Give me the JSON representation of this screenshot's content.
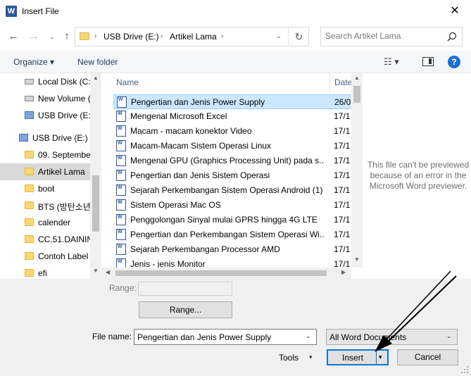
{
  "window": {
    "title": "Insert File",
    "logo": "W",
    "close_glyph": "✕"
  },
  "nav": {
    "back_glyph": "←",
    "forward_glyph": "→",
    "recent_glyph": "⌄",
    "up_glyph": "↑",
    "breadcrumbs": [
      "USB Drive (E:)",
      "Artikel Lama"
    ],
    "separator": "›",
    "dropdown_glyph": "⌄",
    "refresh_glyph": "↻",
    "search_placeholder": "Search Artikel Lama"
  },
  "toolbar": {
    "organize": "Organize ▾",
    "new_folder": "New folder",
    "view_glyph": "☷ ▾",
    "help": "?"
  },
  "nav_pane": {
    "items": [
      {
        "label": "Local Disk (C:)",
        "icon": "drive-icon"
      },
      {
        "label": "New Volume (",
        "icon": "drive-icon"
      },
      {
        "label": "USB Drive (E:)",
        "icon": "usb-icon"
      },
      {
        "label": "USB Drive (E:)",
        "icon": "usb-icon"
      },
      {
        "label": "09. September",
        "icon": "folder-icon"
      },
      {
        "label": "Artikel Lama",
        "icon": "folder-icon"
      },
      {
        "label": "boot",
        "icon": "folder-icon"
      },
      {
        "label": "BTS (방탄소년",
        "icon": "folder-icon"
      },
      {
        "label": "calender",
        "icon": "folder-icon"
      },
      {
        "label": "CC.51.DAININ",
        "icon": "folder-icon"
      },
      {
        "label": "Contoh Label",
        "icon": "folder-icon"
      },
      {
        "label": "efi",
        "icon": "folder-icon"
      }
    ],
    "scroll_up": "▲",
    "scroll_down": "▼"
  },
  "file_list": {
    "columns": {
      "name": "Name",
      "date": "Date"
    },
    "files": [
      {
        "name": "Pengertian dan Jenis Power Supply",
        "date": "26/0"
      },
      {
        "name": "Mengenal Microsoft Excel",
        "date": "17/1"
      },
      {
        "name": "Macam - macam konektor Video",
        "date": "17/1"
      },
      {
        "name": "Macam-Macam Sistem Operasi Linux",
        "date": "17/1"
      },
      {
        "name": "Mengenal GPU (Graphics Processing Unit) pada s...",
        "date": "17/1"
      },
      {
        "name": "Pengertian dan Jenis Sistem Operasi",
        "date": "17/1"
      },
      {
        "name": "Sejarah Perkembangan Sistem Operasi Android (1)",
        "date": "17/1"
      },
      {
        "name": "Sistem Operasi Mac OS",
        "date": "17/1"
      },
      {
        "name": "Penggolongan Sinyal mulai GPRS hingga 4G LTE",
        "date": "17/1"
      },
      {
        "name": "Pengertian dan Perkembangan Sistem Operasi Wi...",
        "date": "17/1"
      },
      {
        "name": "Sejarah Perkembangan Processor AMD",
        "date": "17/1"
      },
      {
        "name": "Jenis - jenis Monitor",
        "date": "17/1"
      }
    ],
    "file_icon_text": "W",
    "scroll_up": "▲",
    "scroll_down": "▼",
    "scroll_left": "◀",
    "scroll_right": "▶"
  },
  "preview": {
    "message": "This file can't be previewed because of an error in the Microsoft Word previewer."
  },
  "bottom": {
    "range_label": "Range:",
    "range_button": "Range...",
    "filename_label": "File name:",
    "filename_value": "Pengertian dan Jenis Power Supply",
    "filename_dd": "⌄",
    "filetype": "All Word Documents",
    "filetype_dd": "⌄",
    "tools": "Tools",
    "tools_dd": "▾",
    "insert": "Insert",
    "insert_dd": "▾",
    "cancel": "Cancel"
  },
  "colors": {
    "selection": "#cce8ff",
    "accent": "#0078d7",
    "word_blue": "#2b579a"
  }
}
